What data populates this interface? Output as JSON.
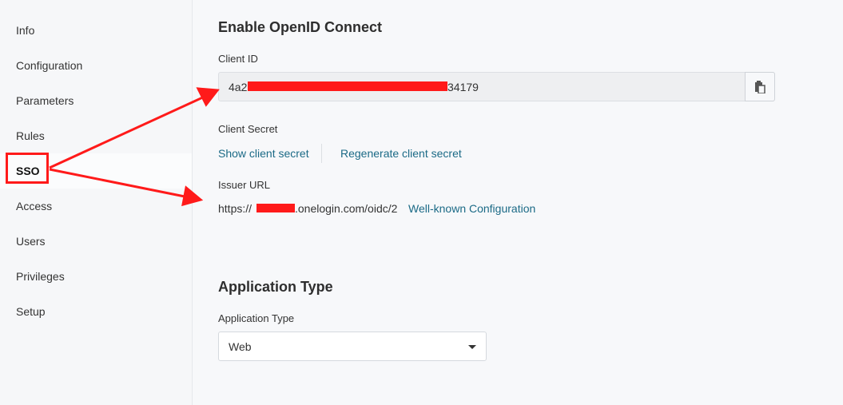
{
  "sidebar": {
    "items": [
      {
        "label": "Info"
      },
      {
        "label": "Configuration"
      },
      {
        "label": "Parameters"
      },
      {
        "label": "Rules"
      },
      {
        "label": "SSO",
        "active": true
      },
      {
        "label": "Access"
      },
      {
        "label": "Users"
      },
      {
        "label": "Privileges"
      },
      {
        "label": "Setup"
      }
    ]
  },
  "openid": {
    "title": "Enable OpenID Connect",
    "client_id_label": "Client ID",
    "client_id_prefix": "4a2",
    "client_id_suffix": "34179",
    "copy_icon": "clipboard-icon",
    "client_secret_label": "Client Secret",
    "show_secret": "Show client secret",
    "regenerate_secret": "Regenerate client secret",
    "issuer_label": "Issuer URL",
    "issuer_prefix": "https://",
    "issuer_suffix": ".onelogin.com/oidc/2",
    "well_known": "Well-known Configuration"
  },
  "app_type": {
    "title": "Application Type",
    "label": "Application Type",
    "selected": "Web"
  },
  "colors": {
    "annotation": "#ff1a1a",
    "link": "#1b6a86",
    "background": "#f7f8fa"
  }
}
